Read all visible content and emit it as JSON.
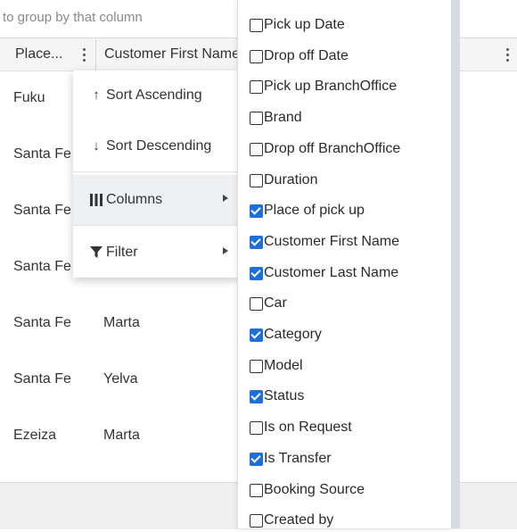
{
  "group_hint": "to group by that column",
  "header": {
    "place_col": "Place...",
    "customer_first_col": "Customer First Name"
  },
  "rows": [
    {
      "place": "Fuku",
      "first": ""
    },
    {
      "place": "Santa Fe",
      "first": ""
    },
    {
      "place": "Santa Fe",
      "first": ""
    },
    {
      "place": "Santa Fe",
      "first": ""
    },
    {
      "place": "Santa Fe",
      "first": "Marta"
    },
    {
      "place": "Santa Fe",
      "first": "Yelva"
    },
    {
      "place": "Ezeiza",
      "first": "Marta"
    }
  ],
  "column_menu": {
    "sort_asc": "Sort Ascending",
    "sort_desc": "Sort Descending",
    "columns": "Columns",
    "filter": "Filter"
  },
  "columns_panel": [
    {
      "label": "Pick up Date",
      "checked": false
    },
    {
      "label": "Drop off Date",
      "checked": false
    },
    {
      "label": "Pick up BranchOffice",
      "checked": false
    },
    {
      "label": "Brand",
      "checked": false
    },
    {
      "label": "Drop off BranchOffice",
      "checked": false
    },
    {
      "label": "Duration",
      "checked": false
    },
    {
      "label": "Place of pick up",
      "checked": true
    },
    {
      "label": "Customer First Name",
      "checked": true
    },
    {
      "label": "Customer Last Name",
      "checked": true
    },
    {
      "label": "Car",
      "checked": false
    },
    {
      "label": "Category",
      "checked": true
    },
    {
      "label": "Model",
      "checked": false
    },
    {
      "label": "Status",
      "checked": true
    },
    {
      "label": "Is on Request",
      "checked": false
    },
    {
      "label": "Is Transfer",
      "checked": true
    },
    {
      "label": "Booking Source",
      "checked": false
    },
    {
      "label": "Created by",
      "checked": false
    }
  ],
  "colors": {
    "accent": "#1e6fd9"
  }
}
